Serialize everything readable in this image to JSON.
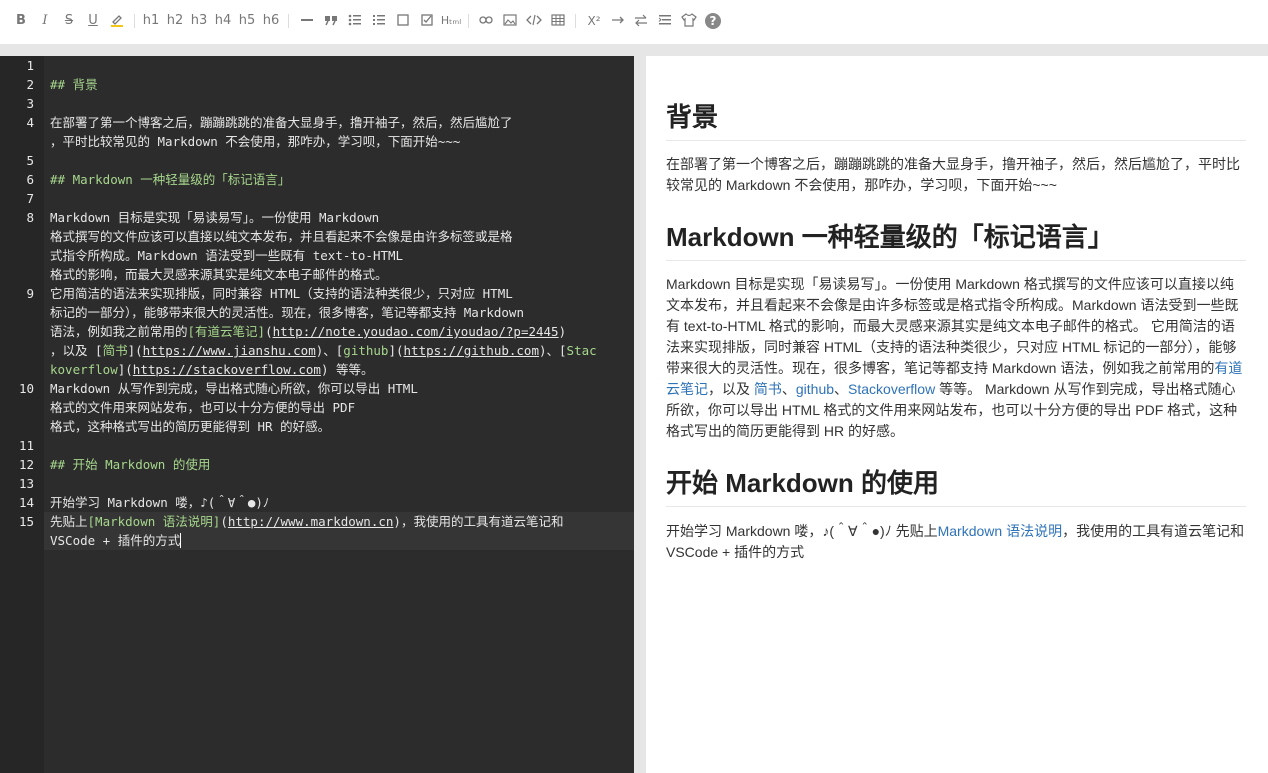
{
  "toolbar": {
    "bold": "B",
    "italic": "I",
    "strike": "S",
    "underline": "U",
    "h1": "h1",
    "h2": "h2",
    "h3": "h3",
    "h4": "h4",
    "h5": "h5",
    "h6": "h6",
    "html": "Hₜₘₗ",
    "sup": "X²",
    "help": "?"
  },
  "editor": {
    "lines": [
      {
        "n": "1"
      },
      {
        "n": "2"
      },
      {
        "n": "3"
      },
      {
        "n": "4"
      },
      {
        "n": "5"
      },
      {
        "n": "6"
      },
      {
        "n": "7"
      },
      {
        "n": "8"
      },
      {
        "n": "9"
      },
      {
        "n": "10"
      },
      {
        "n": "11"
      },
      {
        "n": "12"
      },
      {
        "n": "13"
      },
      {
        "n": "14"
      },
      {
        "n": "15"
      }
    ],
    "l2": "## 背景",
    "l4a": "在部署了第一个博客之后，蹦蹦跳跳的准备大显身手，撸开袖子，然后，然后尴尬了",
    "l4b": "，平时比较常见的 Markdown 不会使用，那咋办，学习呗，下面开始~~~",
    "l6": "## Markdown 一种轻量级的「标记语言」",
    "l8a": "Markdown 目标是实现「易读易写」。一份使用 Markdown",
    "l8b": "格式撰写的文件应该可以直接以纯文本发布，并且看起来不会像是由许多标签或是格",
    "l8c": "式指令所构成。Markdown 语法受到一些既有 text-to-HTML",
    "l8d": "格式的影响，而最大灵感来源其实是纯文本电子邮件的格式。",
    "l9a": "它用简洁的语法来实现排版，同时兼容 HTML（支持的语法种类很少，只对应 HTML",
    "l9b": "标记的一部分），能够带来很大的灵活性。现在，很多博客，笔记等都支持 Markdown",
    "l9c1": "语法，例如我之前常用的",
    "l9c_link": "[有道云笔记]",
    "l9c_p1": "(",
    "l9c_url": "http://note.youdao.com/iyoudao/?p=2445",
    "l9c_p2": ")",
    "l9d1": "，以及 [",
    "l9d_link": "简书",
    "l9d2": "](",
    "l9d_url1": "https://www.jianshu.com",
    "l9d3": ")、[",
    "l9d_link2": "github",
    "l9d4": "](",
    "l9d_url2": "https://github.com",
    "l9d5": ")、[",
    "l9d_link3": "Stac",
    "l9e_link3b": "koverflow",
    "l9e1": "](",
    "l9e_url": "https://stackoverflow.com",
    "l9e2": ") 等等。",
    "l10a": "Markdown 从写作到完成，导出格式随心所欲，你可以导出 HTML",
    "l10b": "格式的文件用来网站发布，也可以十分方便的导出 PDF",
    "l10c": "格式，这种格式写出的简历更能得到 HR 的好感。",
    "l12": "## 开始 Markdown 的使用",
    "l14": "开始学习 Markdown 喽，♪(＾∀＾●)ﾉ",
    "l15a1": "先贴上",
    "l15a_link": "[Markdown 语法说明]",
    "l15a_p1": "(",
    "l15a_url": "http://www.markdown.cn",
    "l15a2": ")，我使用的工具有道云笔记和",
    "l15b": "VSCode + 插件的方式"
  },
  "preview": {
    "h_bg": "背景",
    "p1": "在部署了第一个博客之后，蹦蹦跳跳的准备大显身手，撸开袖子，然后，然后尴尬了，平时比较常见的 Markdown 不会使用，那咋办，学习呗，下面开始~~~",
    "h_md": "Markdown 一种轻量级的「标记语言」",
    "p2a": "Markdown 目标是实现「易读易写」。一份使用 Markdown 格式撰写的文件应该可以直接以纯文本发布，并且看起来不会像是由许多标签或是格式指令所构成。Markdown 语法受到一些既有 text-to-HTML 格式的影响，而最大灵感来源其实是纯文本电子邮件的格式。 它用简洁的语法来实现排版，同时兼容 HTML（支持的语法种类很少，只对应 HTML 标记的一部分），能够带来很大的灵活性。现在，很多博客，笔记等都支持 Markdown 语法，例如我之前常用的",
    "link_youdao": "有道云笔记",
    "p2b": "，以及 ",
    "link_jianshu": "简书",
    "sep1": "、",
    "link_github": "github",
    "sep2": "、",
    "link_so": "Stackoverflow",
    "p2c": " 等等。 Markdown 从写作到完成，导出格式随心所欲，你可以导出 HTML 格式的文件用来网站发布，也可以十分方便的导出 PDF 格式，这种格式写出的简历更能得到 HR 的好感。",
    "h_start": "开始 Markdown 的使用",
    "p3a": "开始学习 Markdown 喽，♪(＾∀＾●)ﾉ 先贴上",
    "link_mdsyntax": "Markdown 语法说明",
    "p3b": "，我使用的工具有道云笔记和 VSCode + 插件的方式"
  }
}
